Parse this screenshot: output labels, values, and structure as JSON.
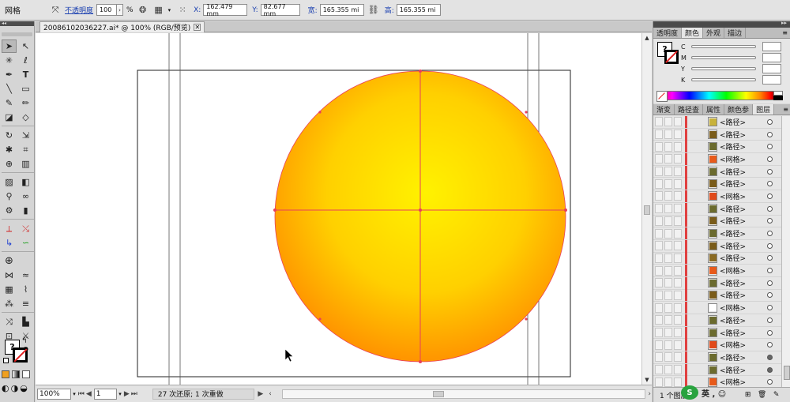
{
  "control_bar": {
    "object_label": "网格",
    "opacity_label": "不透明度",
    "opacity_value": "100",
    "opacity_unit": "%",
    "x_label": "X:",
    "x_value": "162.479 mm",
    "y_label": "Y:",
    "y_value": "82.677 mm",
    "w_label": "宽:",
    "w_value": "165.355 mi",
    "h_label": "高:",
    "h_value": "165.355 mi"
  },
  "document": {
    "tab_title": "20086102036227.ai* @ 100% (RGB/预览)"
  },
  "status_bar": {
    "zoom": "100%",
    "page": "1",
    "message": "27 次还原; 1 次重做"
  },
  "color_panel": {
    "tabs": [
      "透明度",
      "颜色",
      "外观",
      "描边"
    ],
    "active_tab": "颜色",
    "channels": [
      "C",
      "M",
      "Y",
      "K"
    ],
    "fill_glyph": "?"
  },
  "layers_panel": {
    "tabs": [
      "渐变",
      "路径查",
      "属性",
      "颜色参",
      "图层"
    ],
    "active_tab": "图层",
    "items": [
      {
        "label": "<路径>",
        "thumb": "#c8b23a",
        "target": "o"
      },
      {
        "label": "<路径>",
        "thumb": "#7a5c1a",
        "target": "o"
      },
      {
        "label": "<路径>",
        "thumb": "#6b6b2e",
        "target": "o"
      },
      {
        "label": "<网格>",
        "thumb": "#e85a1a",
        "target": "o"
      },
      {
        "label": "<路径>",
        "thumb": "#6b6b2e",
        "target": "o"
      },
      {
        "label": "<路径>",
        "thumb": "#7a5c1a",
        "target": "o"
      },
      {
        "label": "<网格>",
        "thumb": "#e04a1a",
        "target": "o"
      },
      {
        "label": "<路径>",
        "thumb": "#6b6b2e",
        "target": "o"
      },
      {
        "label": "<路径>",
        "thumb": "#7a5c1a",
        "target": "o"
      },
      {
        "label": "<路径>",
        "thumb": "#6b6b2e",
        "target": "o"
      },
      {
        "label": "<路径>",
        "thumb": "#7a5c1a",
        "target": "o"
      },
      {
        "label": "<路径>",
        "thumb": "#8a6a22",
        "target": "o"
      },
      {
        "label": "<网格>",
        "thumb": "#e85a1a",
        "target": "o"
      },
      {
        "label": "<路径>",
        "thumb": "#6b6b2e",
        "target": "o"
      },
      {
        "label": "<路径>",
        "thumb": "#7a5c1a",
        "target": "o"
      },
      {
        "label": "<网格>",
        "thumb": "#ffffff",
        "target": "o"
      },
      {
        "label": "<路径>",
        "thumb": "#6b6b2e",
        "target": "o"
      },
      {
        "label": "<路径>",
        "thumb": "#6b6b2e",
        "target": "o"
      },
      {
        "label": "<网格>",
        "thumb": "#e04a1a",
        "target": "o"
      },
      {
        "label": "<路径>",
        "thumb": "#6b6b2e",
        "target": "fill"
      },
      {
        "label": "<路径>",
        "thumb": "#6b6b2e",
        "target": "fill"
      },
      {
        "label": "<网格>",
        "thumb": "#e85a1a",
        "target": "o"
      }
    ],
    "footer_label": "1 个图层"
  },
  "watermark": {
    "badge": "S",
    "text": "英 , ☺"
  },
  "colors": {
    "mesh_center": "#fff200",
    "mesh_edge": "#ff8a00",
    "mesh_lines": "#e8405a",
    "guide_lines": "#555555"
  }
}
